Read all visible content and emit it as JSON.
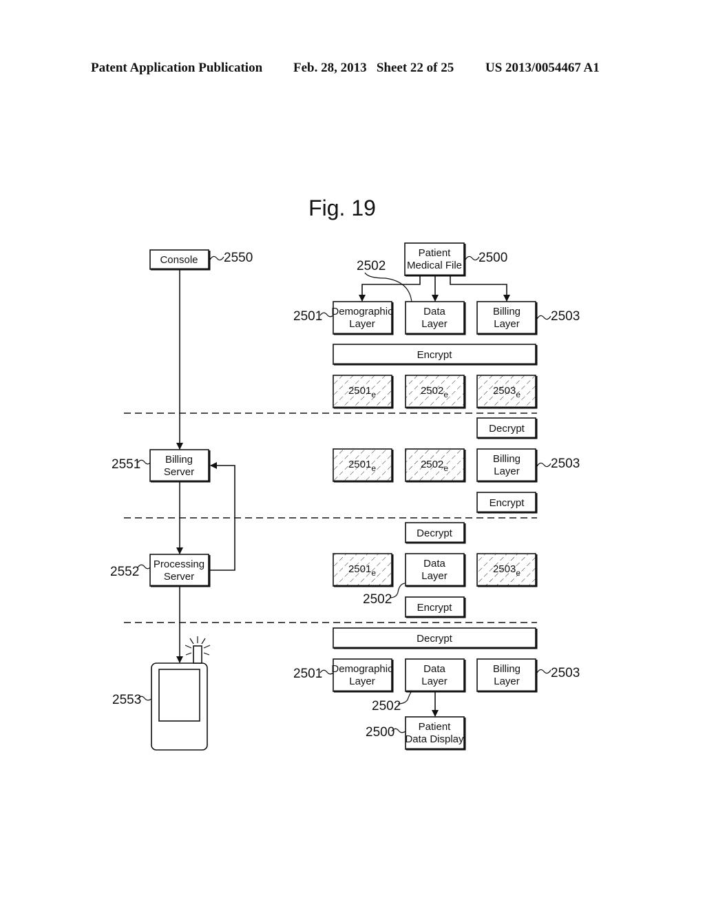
{
  "header": {
    "publication": "Patent Application Publication",
    "date_sheet": "Feb. 28, 2013   Sheet 22 of 25",
    "number": "US 2013/0054467 A1"
  },
  "figure": {
    "title": "Fig. 19",
    "left_column": {
      "console": {
        "label": "Console",
        "ref": "2550"
      },
      "billing_server": {
        "line1": "Billing",
        "line2": "Server",
        "ref": "2551"
      },
      "processing_server": {
        "line1": "Processing",
        "line2": "Server",
        "ref": "2552"
      },
      "mobile_device": {
        "ref": "2553"
      }
    },
    "section1": {
      "patient_medical_file": {
        "line1": "Patient",
        "line2": "Medical File",
        "ref": "2500"
      },
      "data_ref": "2502",
      "demographic_layer": {
        "line1": "Demographic",
        "line2": "Layer",
        "ref": "2501"
      },
      "data_layer": {
        "line1": "Data",
        "line2": "Layer"
      },
      "billing_layer": {
        "line1": "Billing",
        "line2": "Layer",
        "ref": "2503"
      },
      "encrypt": "Encrypt",
      "encrypted": [
        {
          "num": "2501",
          "sub": "e"
        },
        {
          "num": "2502",
          "sub": "e"
        },
        {
          "num": "2503",
          "sub": "e"
        }
      ]
    },
    "section2": {
      "decrypt": "Decrypt",
      "encrypted": [
        {
          "num": "2501",
          "sub": "e"
        },
        {
          "num": "2502",
          "sub": "e"
        }
      ],
      "billing_layer": {
        "line1": "Billing",
        "line2": "Layer",
        "ref": "2503"
      },
      "encrypt": "Encrypt"
    },
    "section3": {
      "decrypt": "Decrypt",
      "encrypted": [
        {
          "num": "2501",
          "sub": "e"
        },
        {
          "num": "2503",
          "sub": "e"
        }
      ],
      "data_layer": {
        "line1": "Data",
        "line2": "Layer",
        "ref": "2502"
      },
      "encrypt": "Encrypt"
    },
    "section4": {
      "decrypt": "Decrypt",
      "demographic_layer": {
        "line1": "Demographic",
        "line2": "Layer",
        "ref": "2501"
      },
      "data_layer": {
        "line1": "Data",
        "line2": "Layer",
        "ref": "2502"
      },
      "billing_layer": {
        "line1": "Billing",
        "line2": "Layer",
        "ref": "2503"
      },
      "patient_data_display": {
        "line1": "Patient",
        "line2": "Data Display",
        "ref": "2500"
      }
    }
  }
}
